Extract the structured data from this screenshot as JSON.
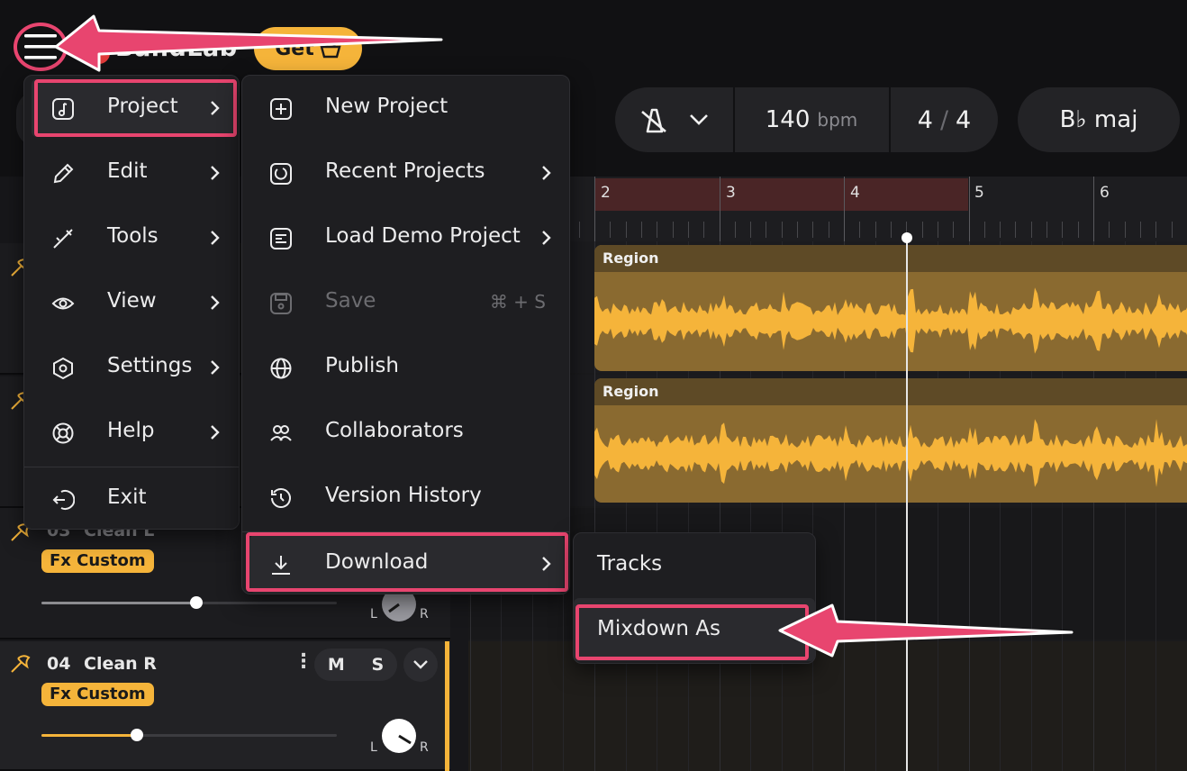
{
  "app": {
    "logo_text": "BandLab",
    "get_label": "Get"
  },
  "transport": {
    "bpm_value": "140",
    "bpm_unit": "bpm",
    "time_sig_top": "4",
    "time_sig_sep": "/",
    "time_sig_bottom": "4",
    "key": "B♭ maj"
  },
  "ruler": {
    "bars": [
      "2",
      "3",
      "4",
      "5",
      "6"
    ]
  },
  "regions": [
    {
      "label": "Region"
    },
    {
      "label": "Region"
    }
  ],
  "tracks": [
    {
      "number": "03",
      "name": "Clean L",
      "fx": "Fx Custom",
      "volume": 0.53,
      "pan_left": "L",
      "pan_right": "R"
    },
    {
      "number": "04",
      "name": "Clean R",
      "fx": "Fx Custom",
      "volume": 0.32,
      "pan_left": "L",
      "pan_right": "R",
      "mute": "M",
      "solo": "S"
    }
  ],
  "main_menu": {
    "items": [
      {
        "label": "Project",
        "icon": "music-note-icon",
        "has_submenu": true,
        "selected": true
      },
      {
        "label": "Edit",
        "icon": "pencil-icon",
        "has_submenu": true
      },
      {
        "label": "Tools",
        "icon": "tools-icon",
        "has_submenu": true
      },
      {
        "label": "View",
        "icon": "eye-icon",
        "has_submenu": true
      },
      {
        "label": "Settings",
        "icon": "hexagon-settings-icon",
        "has_submenu": true
      },
      {
        "label": "Help",
        "icon": "lifebuoy-icon",
        "has_submenu": true
      },
      {
        "label": "Exit",
        "icon": "exit-icon",
        "has_submenu": false
      }
    ]
  },
  "project_menu": {
    "items": [
      {
        "label": "New Project",
        "icon": "plus-square-icon"
      },
      {
        "label": "Recent Projects",
        "icon": "recent-icon",
        "has_submenu": true
      },
      {
        "label": "Load Demo Project",
        "icon": "list-icon",
        "has_submenu": true
      },
      {
        "label": "Save",
        "icon": "save-icon",
        "shortcut": "⌘ + S",
        "disabled": true
      },
      {
        "label": "Publish",
        "icon": "globe-icon"
      },
      {
        "label": "Collaborators",
        "icon": "collaborators-icon"
      },
      {
        "label": "Version History",
        "icon": "history-icon"
      },
      {
        "label": "Download",
        "icon": "download-icon",
        "has_submenu": true,
        "selected": true
      }
    ]
  },
  "download_menu": {
    "items": [
      {
        "label": "Tracks"
      },
      {
        "label": "Mixdown As",
        "selected": true
      }
    ]
  },
  "colors": {
    "accent": "#f5b43a",
    "highlight": "#e8456f",
    "background": "#111113",
    "menu_bg": "#1e1e21"
  }
}
